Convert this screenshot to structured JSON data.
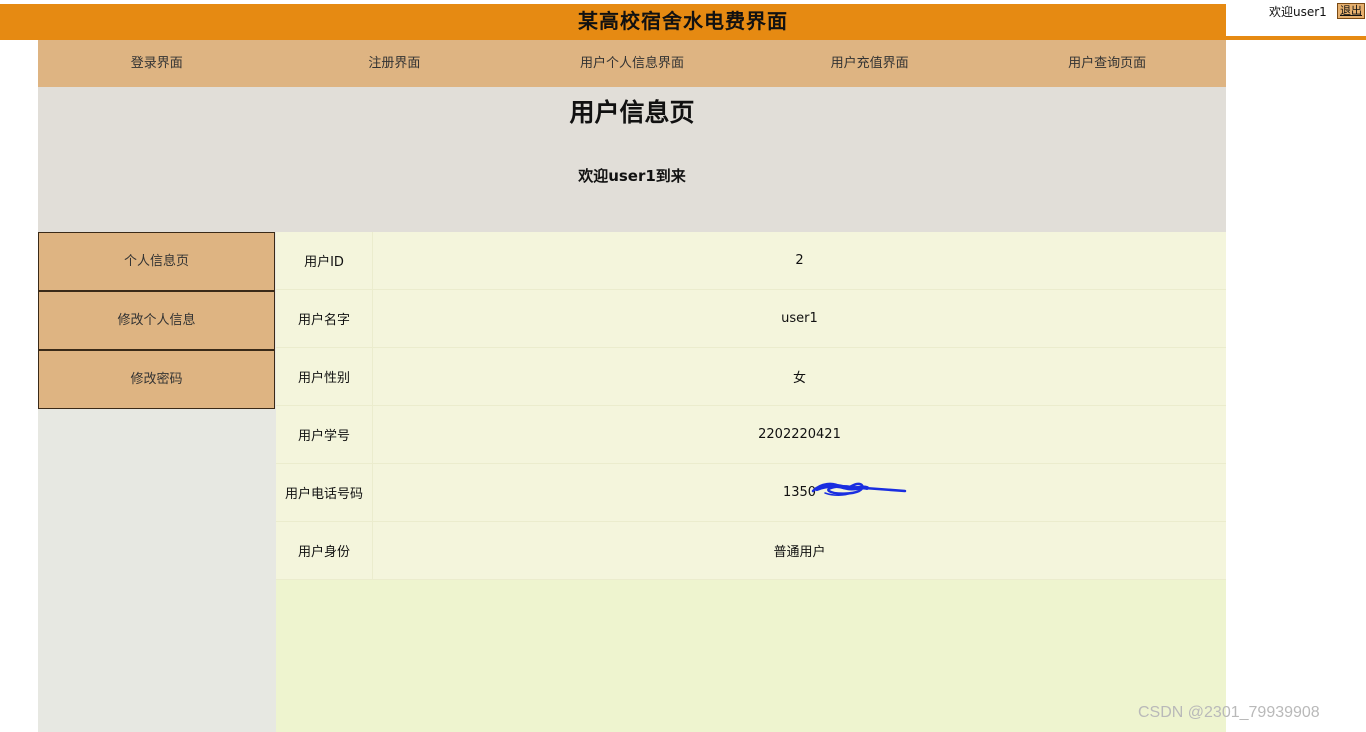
{
  "header": {
    "title": "某高校宿舍水电费界面",
    "welcome": "欢迎user1",
    "logout_label": "退出"
  },
  "nav": {
    "items": [
      {
        "label": "登录界面"
      },
      {
        "label": "注册界面"
      },
      {
        "label": "用户个人信息界面"
      },
      {
        "label": "用户充值界面"
      },
      {
        "label": "用户查询页面"
      }
    ]
  },
  "hero": {
    "title": "用户信息页",
    "greeting": "欢迎user1到来"
  },
  "sidebar": {
    "items": [
      {
        "label": "个人信息页"
      },
      {
        "label": "修改个人信息"
      },
      {
        "label": "修改密码"
      }
    ]
  },
  "info": {
    "rows": [
      {
        "label": "用户ID",
        "value": "2"
      },
      {
        "label": "用户名字",
        "value": "user1"
      },
      {
        "label": "用户性别",
        "value": "女"
      },
      {
        "label": "用户学号",
        "value": "2202220421"
      },
      {
        "label": "用户电话号码",
        "value": "1350"
      },
      {
        "label": "用户身份",
        "value": "普通用户"
      }
    ]
  },
  "watermark": "CSDN @2301_79939908",
  "colors": {
    "topbar": "#e68a12",
    "nav": "#deb482",
    "hero": "#e1ded8",
    "sidebar": "#e7e8e2",
    "content": "#eef4cf",
    "table": "#f4f5dc",
    "scribble": "#1a2ee0"
  }
}
